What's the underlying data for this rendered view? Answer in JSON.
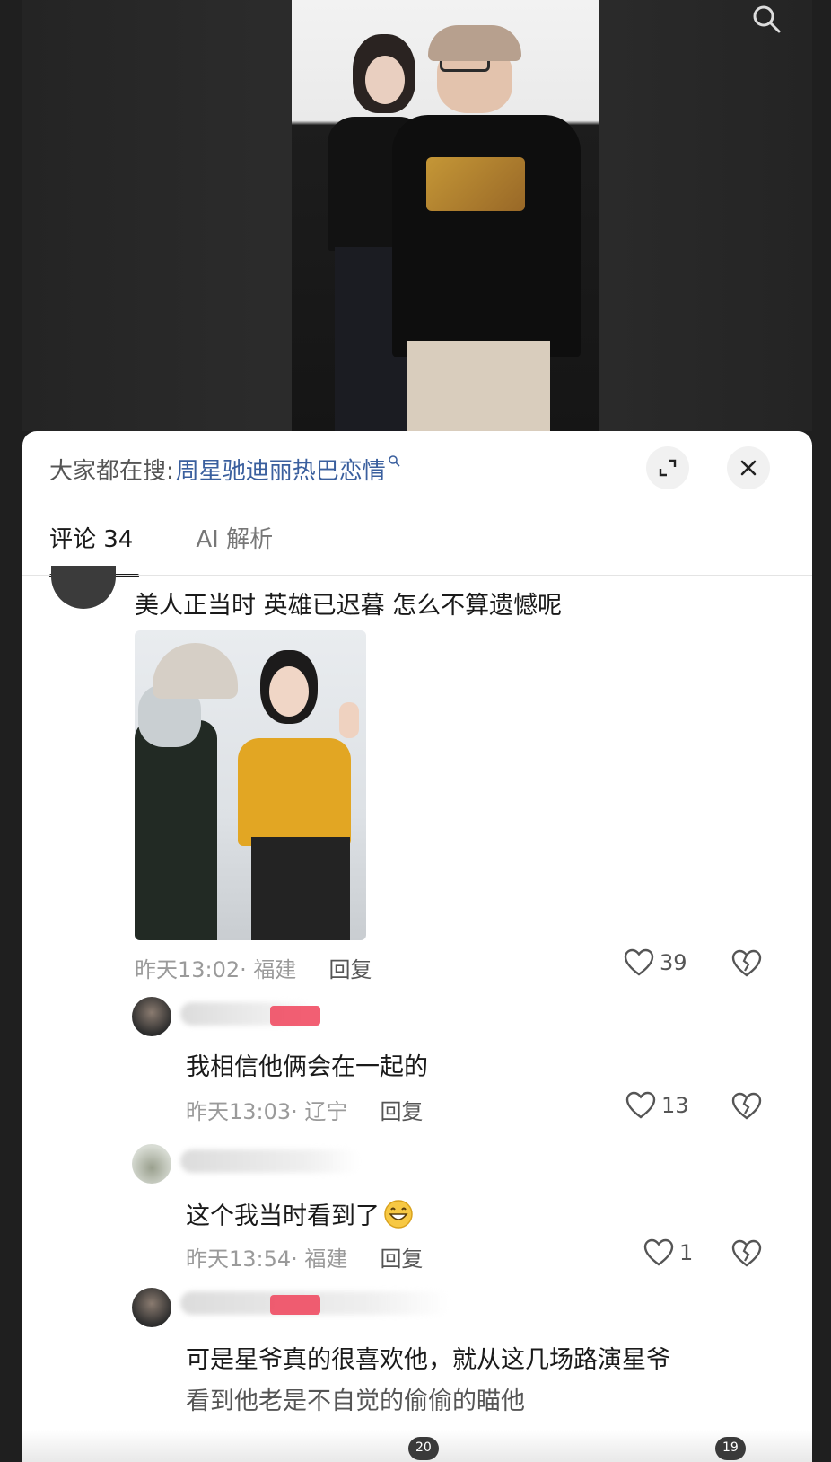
{
  "search": {
    "prefix": "大家都在搜:",
    "term": "周星驰迪丽热巴恋情"
  },
  "tabs": [
    {
      "label": "评论 34",
      "active": true
    },
    {
      "label": "AI 解析",
      "active": false
    }
  ],
  "comments": [
    {
      "text": "美人正当时 英雄已迟暮 怎么不算遗憾呢",
      "time": "昨天13:02",
      "location": "· 福建",
      "reply_label": "回复",
      "likes": "39",
      "has_image": true
    },
    {
      "text": "我相信他俩会在一起的",
      "time": "昨天13:03",
      "location": "· 辽宁",
      "reply_label": "回复",
      "likes": "13",
      "author_badge": true
    },
    {
      "text": "这个我当时看到了",
      "time": "昨天13:54",
      "location": "· 福建",
      "reply_label": "回复",
      "likes": "1",
      "emoji": "grinning-face-icon"
    },
    {
      "text": "可是星爷真的很喜欢他，就从这几场路演星爷",
      "text_cont": "看到他老是不自觉的偷偷的瞄他",
      "author_badge": true
    }
  ],
  "bottom_badges": [
    "20",
    "19"
  ],
  "colors": {
    "search_term": "#3a5f9e",
    "author_badge": "#f0435a",
    "meta_text": "#9a9a9a"
  },
  "icons": [
    "search-icon",
    "expand-icon",
    "close-icon",
    "heart-icon",
    "broken-heart-icon"
  ]
}
